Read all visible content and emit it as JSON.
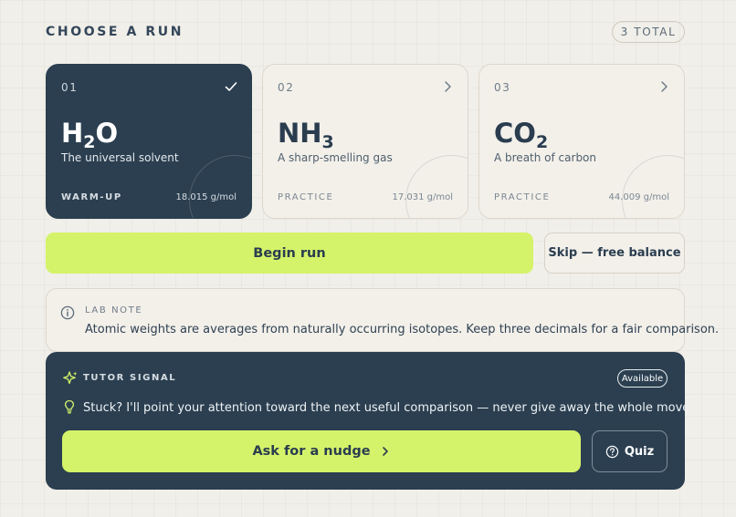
{
  "header": {
    "title": "CHOOSE A RUN",
    "total_badge": "3 TOTAL"
  },
  "runs": [
    {
      "num": "01",
      "formula_main": "H",
      "formula_sub": "2",
      "formula_tail": "O",
      "desc": "The universal solvent",
      "tier": "WARM-UP",
      "mass": "18.015 g/mol",
      "selected": true,
      "corner_icon": "check-icon"
    },
    {
      "num": "02",
      "formula_main": "NH",
      "formula_sub": "3",
      "formula_tail": "",
      "desc": "A sharp-smelling gas",
      "tier": "PRACTICE",
      "mass": "17.031 g/mol",
      "selected": false,
      "corner_icon": "chevron-right-icon"
    },
    {
      "num": "03",
      "formula_main": "CO",
      "formula_sub": "2",
      "formula_tail": "",
      "desc": "A breath of carbon",
      "tier": "PRACTICE",
      "mass": "44.009 g/mol",
      "selected": false,
      "corner_icon": "chevron-right-icon"
    }
  ],
  "actions": {
    "begin_label": "Begin run",
    "skip_label": "Skip — free balance"
  },
  "lab_note": {
    "label": "LAB NOTE",
    "text": "Atomic weights are averages from naturally occurring isotopes. Keep three decimals for a fair comparison.",
    "icon": "info-icon"
  },
  "tutor": {
    "label": "TUTOR SIGNAL",
    "badge": "Available",
    "message": "Stuck? I'll point your attention toward the next useful comparison — never give away the whole move.",
    "nudge_label": "Ask for a nudge",
    "quiz_label": "Quiz",
    "icons": [
      "sparkle-icon",
      "lightbulb-icon",
      "chevron-right-icon",
      "question-circle-icon"
    ]
  },
  "colors": {
    "background": "#f1efe9",
    "navy": "#2b3f50",
    "accent": "#d5f36a",
    "card": "#f3f0ea"
  }
}
